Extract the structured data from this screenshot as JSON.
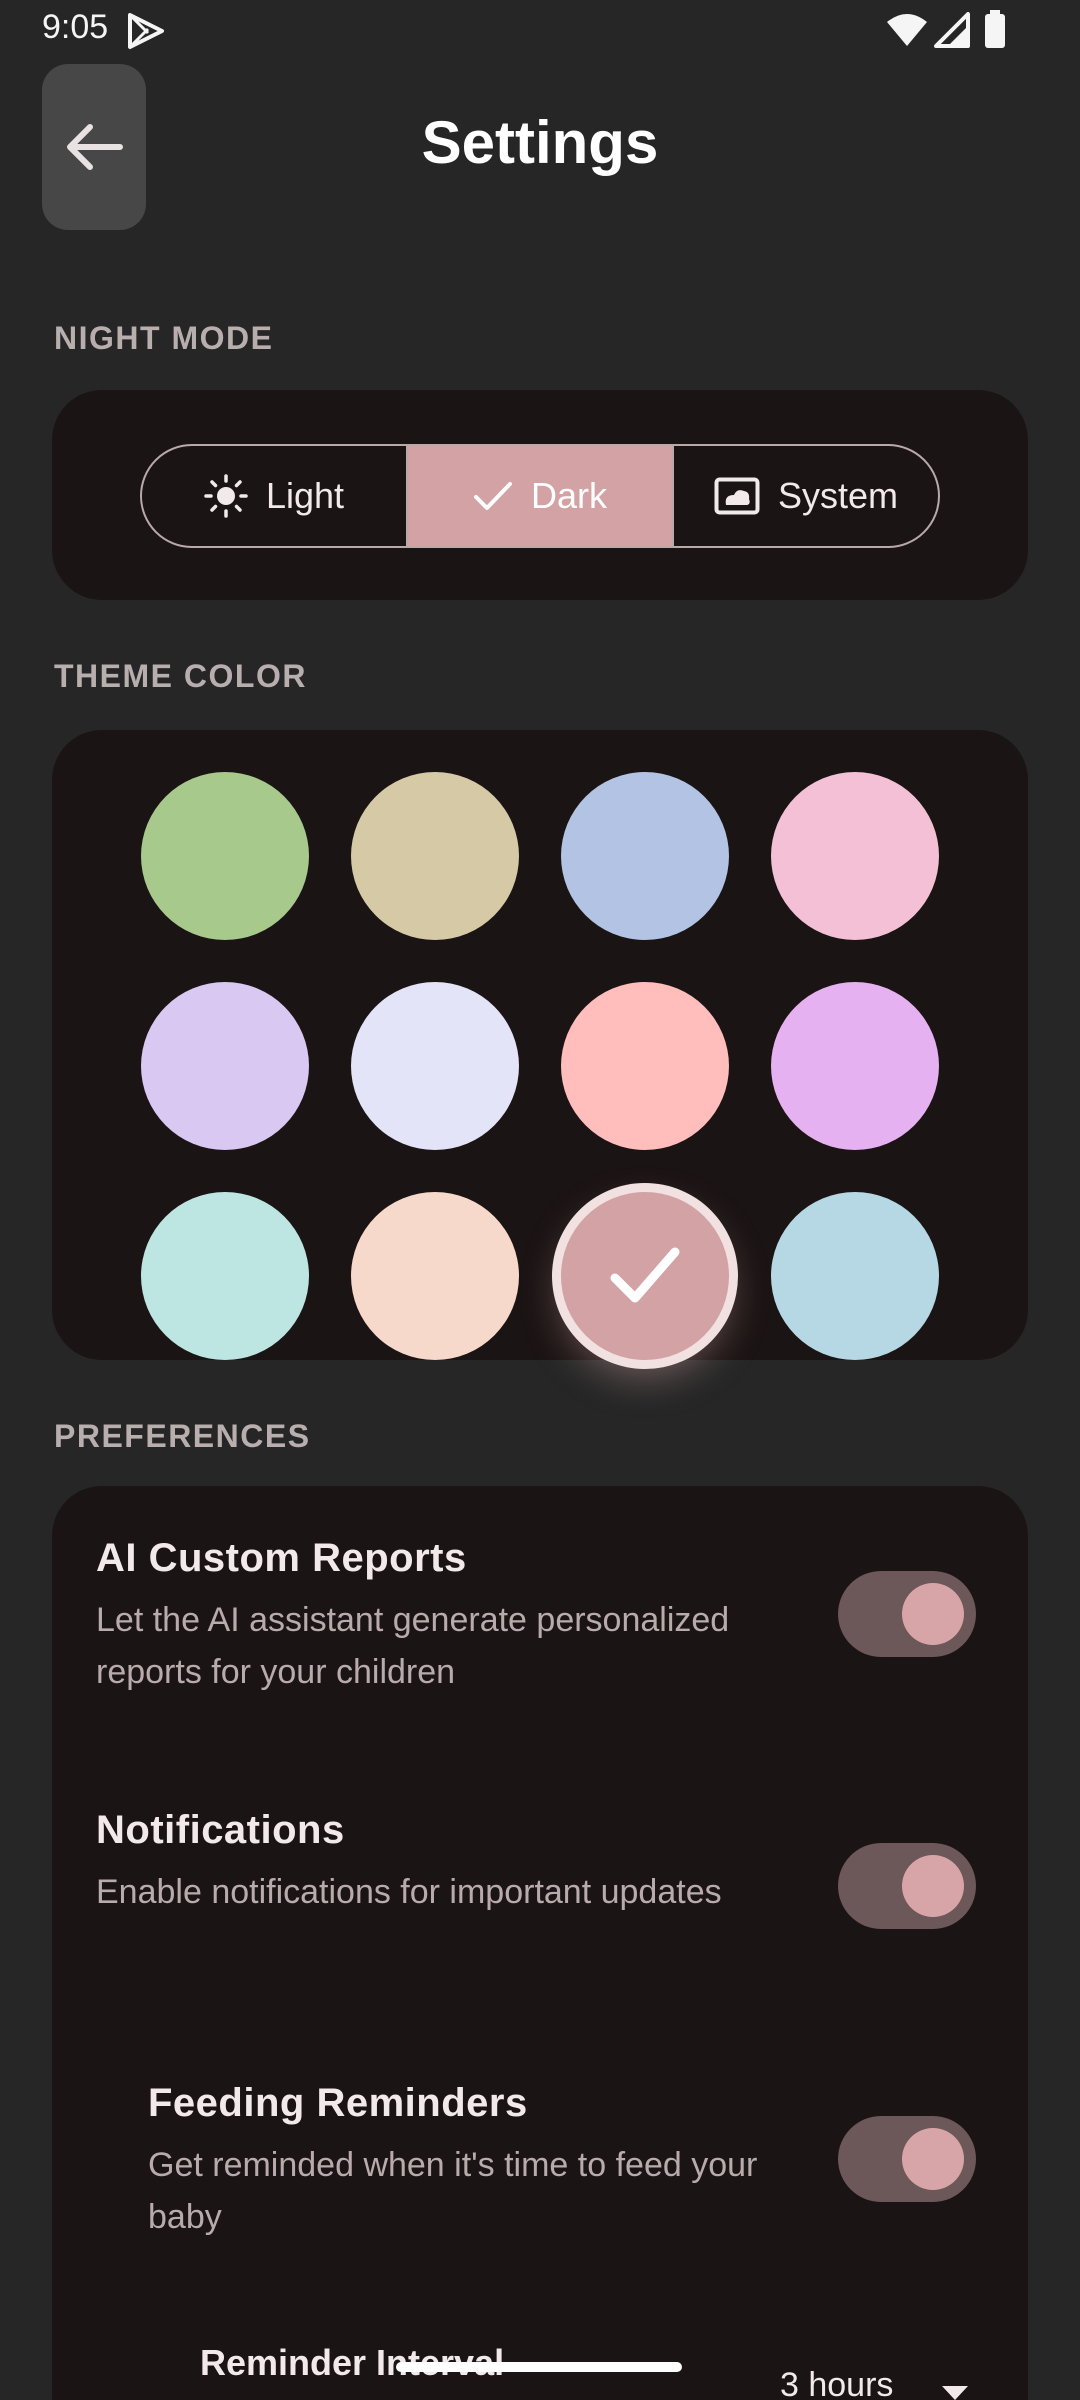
{
  "status_bar": {
    "time": "9:05"
  },
  "header": {
    "title": "Settings"
  },
  "night_mode": {
    "section_label": "NIGHT MODE",
    "options": [
      {
        "label": "Light",
        "icon": "sun-icon"
      },
      {
        "label": "Dark",
        "icon": "check-icon"
      },
      {
        "label": "System",
        "icon": "system-display-icon"
      }
    ],
    "selected": "Dark"
  },
  "theme_color": {
    "section_label": "THEME COLOR",
    "swatches": [
      "#a8c98c",
      "#d6caa6",
      "#b2c3e3",
      "#f4c0d6",
      "#d8c8f2",
      "#e4e4f8",
      "#ffbdbc",
      "#e6b1f0",
      "#bde6e3",
      "#f6d9cb",
      "#d3a2a4",
      "#b6d8e4"
    ],
    "selected_index": 10
  },
  "preferences": {
    "section_label": "PREFERENCES",
    "items": [
      {
        "title": "AI Custom Reports",
        "description": "Let the AI assistant generate personalized reports for your children",
        "enabled": true
      },
      {
        "title": "Notifications",
        "description": "Enable notifications for important updates",
        "enabled": true
      },
      {
        "title": "Feeding Reminders",
        "description": "Get reminded when it's time to feed your baby",
        "enabled": true
      }
    ],
    "reminder_interval": {
      "label": "Reminder Interval",
      "value": "3 hours"
    }
  },
  "colors": {
    "accent": "#d3a2a4",
    "background": "#262626",
    "card": "#1b1414",
    "toggle_track": "#6c5759"
  }
}
